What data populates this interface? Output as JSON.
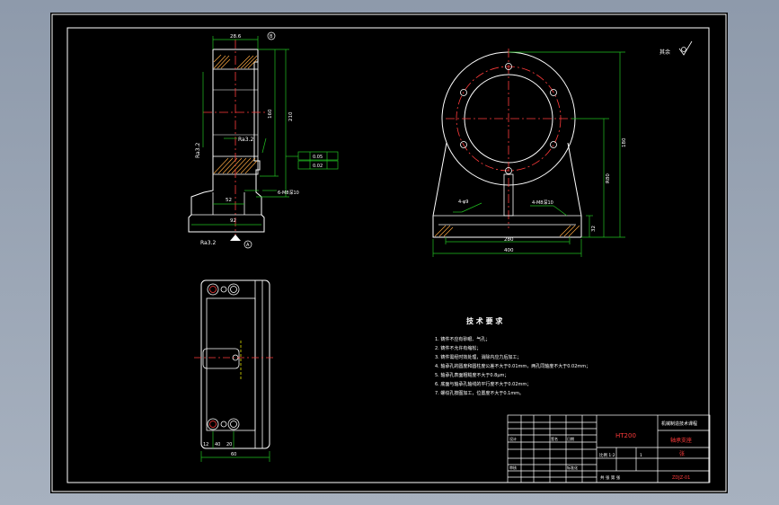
{
  "drawing": {
    "colors": {
      "background": "#000000",
      "frame": "#ffffff",
      "outline": "#ffffff",
      "centerline": "#ff3b3b",
      "dimension": "#21c021",
      "text": "#ffffff",
      "accent": "#ffff00",
      "window": "#9aa5b4"
    },
    "front_view": {
      "dim_top": "28.6",
      "dim_total_height": "210",
      "dim_inner_height": "160",
      "dim_bottom_a": "92",
      "dim_bottom_b": "52",
      "roughness": "Ra3.2",
      "roughness_left": "Ra3.2",
      "roughness_bottom": "Ra3.2",
      "datum": "A",
      "datum_top": "B",
      "callout": "6-M8深10",
      "tolerance_1": "0.05",
      "tolerance_2": "0.02"
    },
    "side_view": {
      "dim_width": "280",
      "dim_total_width": "400",
      "dim_height": "180",
      "dim_center_height": "R80",
      "dim_base": "32",
      "callout_left": "4-φ9",
      "callout_right": "4-M8深10",
      "roughness_others": "其余"
    },
    "top_view": {
      "dim_a": "12",
      "dim_b": "40",
      "dim_c": "20",
      "dim_d": "60"
    },
    "tech_requirements": {
      "title": "技 术 要 求",
      "items": [
        "1. 铸件不应有砂眼、气孔；",
        "2. 铸件不允许有缩松；",
        "3. 铸件需经时效处理，消除内应力后加工；",
        "4. 轴承孔的圆度和圆柱度公差不大于0.01mm，两孔同轴度不大于0.02mm；",
        "5. 轴承孔表面粗糙度不大于0.8μm；",
        "6. 底面与轴承孔轴线的平行度不大于0.02mm；",
        "7. 螺纹孔按图加工，位置度不大于0.1mm。"
      ]
    },
    "title_block": {
      "material": "HT200",
      "title": "轴承支座",
      "company": "机械制造技术课程",
      "scale": "比例 1:2",
      "qty": "1",
      "code": "ZDJZ-01",
      "sheet": "共 张 第 张",
      "designer": "设计",
      "checker": "审核",
      "date": "日期",
      "sign": "签名",
      "std": "标准化",
      "sheet_label": "张"
    }
  }
}
